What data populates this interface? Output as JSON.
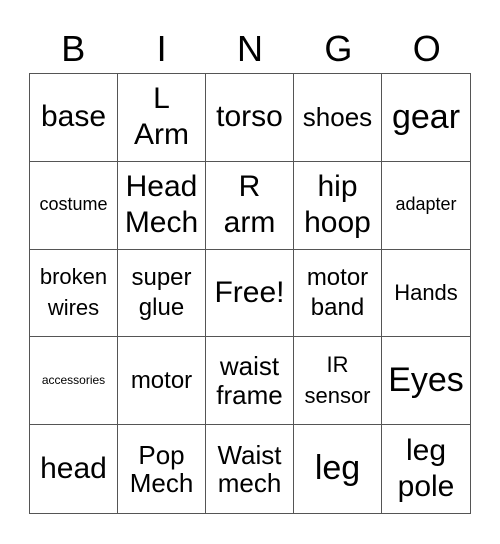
{
  "header": {
    "letters": [
      "B",
      "I",
      "N",
      "G",
      "O"
    ]
  },
  "cells": [
    {
      "text": "base",
      "size": "s-l"
    },
    {
      "text": "L\nArm",
      "size": "s-l"
    },
    {
      "text": "torso",
      "size": "s-l"
    },
    {
      "text": "shoes",
      "size": "s-m"
    },
    {
      "text": "gear",
      "size": "s-xl"
    },
    {
      "text": "costume",
      "size": "s-t"
    },
    {
      "text": "Head\nMech",
      "size": "s-l"
    },
    {
      "text": "R\narm",
      "size": "s-l"
    },
    {
      "text": "hip\nhoop",
      "size": "s-l"
    },
    {
      "text": "adapter",
      "size": "s-t"
    },
    {
      "text": "broken\nwires",
      "size": "s-xs"
    },
    {
      "text": "super\nglue",
      "size": "s-s"
    },
    {
      "text": "Free!",
      "size": "s-l"
    },
    {
      "text": "motor\nband",
      "size": "s-s"
    },
    {
      "text": "Hands",
      "size": "s-xs"
    },
    {
      "text": "accessories",
      "size": "s-tt"
    },
    {
      "text": "motor",
      "size": "s-s"
    },
    {
      "text": "waist\nframe",
      "size": "s-m"
    },
    {
      "text": "IR\nsensor",
      "size": "s-xs"
    },
    {
      "text": "Eyes",
      "size": "s-xl"
    },
    {
      "text": "head",
      "size": "s-l"
    },
    {
      "text": "Pop\nMech",
      "size": "s-m"
    },
    {
      "text": "Waist\nmech",
      "size": "s-m"
    },
    {
      "text": "leg",
      "size": "s-xl"
    },
    {
      "text": "leg\npole",
      "size": "s-l"
    }
  ]
}
